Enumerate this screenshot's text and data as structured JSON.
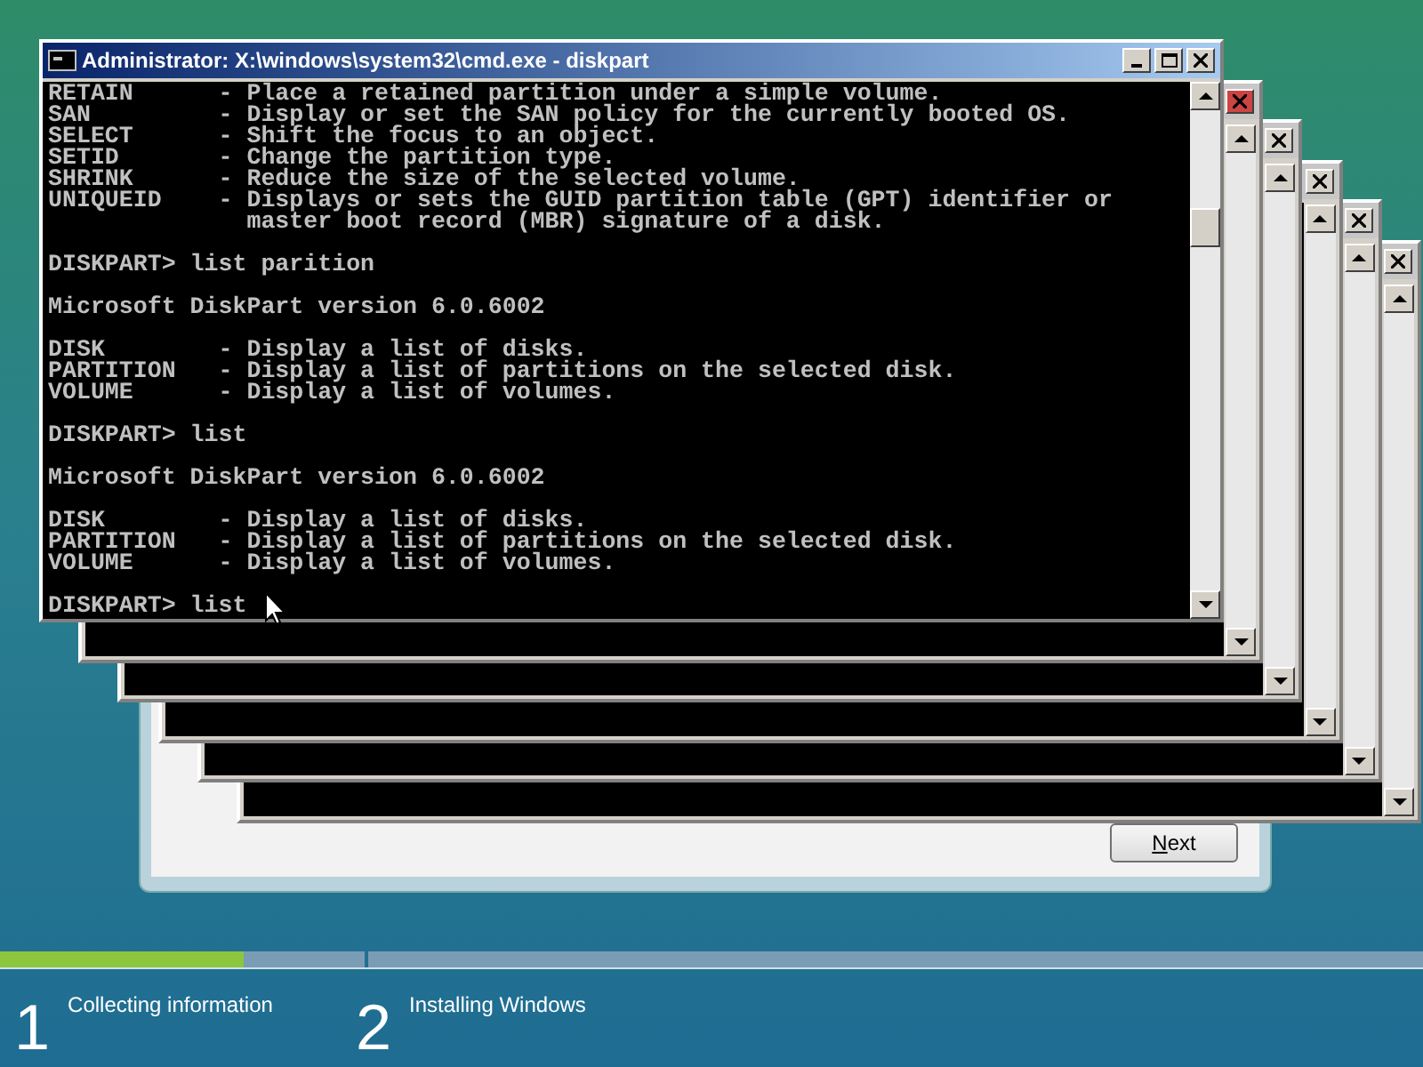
{
  "setup_window": {
    "next_button": "Next"
  },
  "console_window": {
    "title": "Administrator: X:\\windows\\system32\\cmd.exe - diskpart",
    "blocks": [
      [
        "RETAIN      - Place a retained partition under a simple volume.",
        "SAN         - Display or set the SAN policy for the currently booted OS.",
        "SELECT      - Shift the focus to an object.",
        "SETID       - Change the partition type.",
        "SHRINK      - Reduce the size of the selected volume.",
        "UNIQUEID    - Displays or sets the GUID partition table (GPT) identifier or",
        "              master boot record (MBR) signature of a disk."
      ],
      [
        "DISKPART> list parition"
      ],
      [
        "Microsoft DiskPart version 6.0.6002"
      ],
      [
        "DISK        - Display a list of disks.",
        "PARTITION   - Display a list of partitions on the selected disk.",
        "VOLUME      - Display a list of volumes."
      ],
      [
        "DISKPART> list"
      ],
      [
        "Microsoft DiskPart version 6.0.6002"
      ],
      [
        "DISK        - Display a list of disks.",
        "PARTITION   - Display a list of partitions on the selected disk.",
        "VOLUME      - Display a list of volumes."
      ],
      [
        "DISKPART> list"
      ]
    ]
  },
  "steps": [
    {
      "number": "1",
      "label": "Collecting information",
      "level": 0.67
    },
    {
      "number": "2",
      "label": "Installing Windows"
    }
  ]
}
